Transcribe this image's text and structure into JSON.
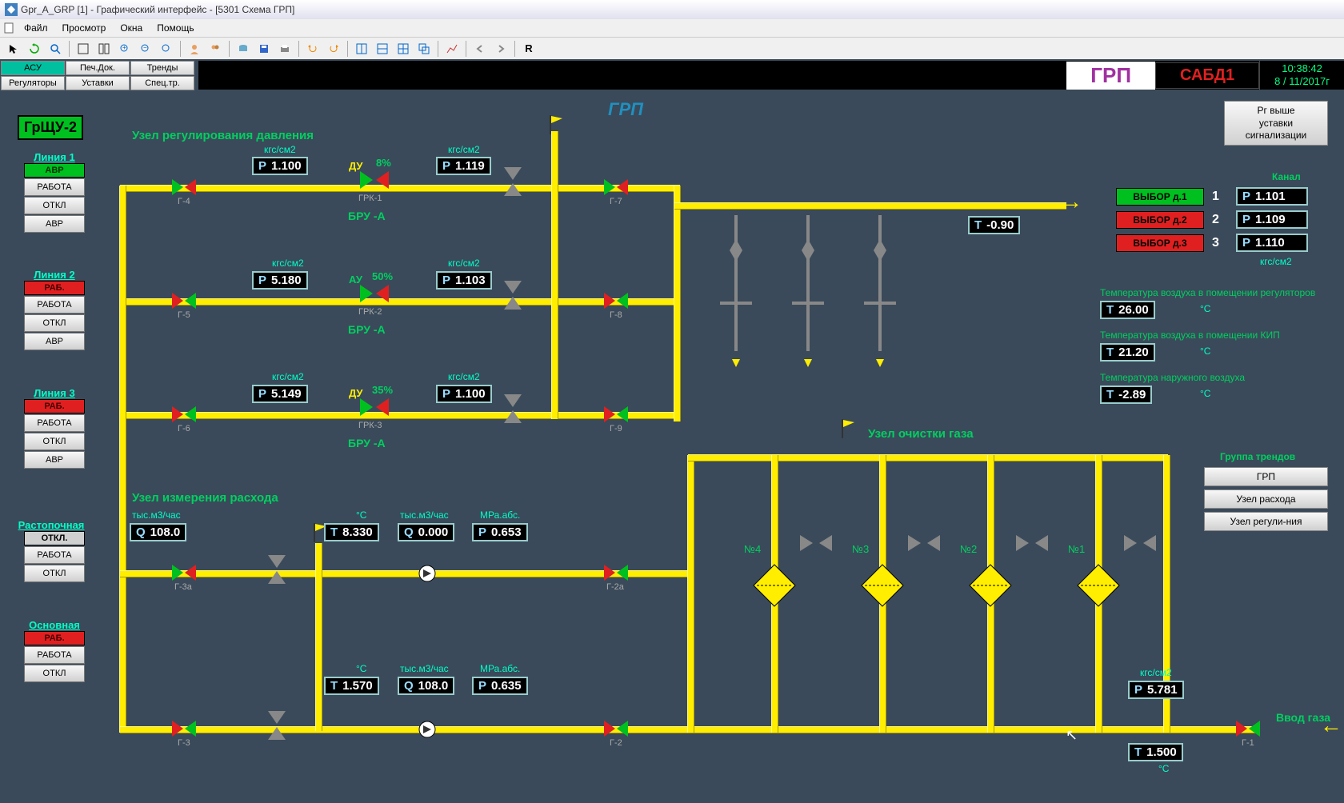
{
  "window": {
    "title": "Gpr_A_GRP [1] - Графический интерфейс - [5301 Схема ГРП]"
  },
  "menu": {
    "file": "Файл",
    "view": "Просмотр",
    "windows": "Окна",
    "help": "Помощь"
  },
  "toolbar_R": "R",
  "topbtns": {
    "r1c1": "АСУ",
    "r1c2": "Печ.Док.",
    "r1c3": "Тренды",
    "r2c1": "Регуляторы",
    "r2c2": "Уставки",
    "r2c3": "Спец.тр."
  },
  "station": "ГРП",
  "alarm": "САБД1",
  "clock": {
    "time": "10:38:42",
    "date": "8 / 11/2017г"
  },
  "main_title": "ГРП",
  "grschu": "ГрЩУ-2",
  "sec": {
    "regul": "Узел регулирования давления",
    "flow": "Узел измерения расхода",
    "clean": "Узел очистки газа"
  },
  "lines": {
    "l1": {
      "name": "Линия 1",
      "status": "АВР",
      "b1": "РАБОТА",
      "b2": "ОТКЛ",
      "b3": "АВР"
    },
    "l2": {
      "name": "Линия 2",
      "status": "РАБ.",
      "b1": "РАБОТА",
      "b2": "ОТКЛ",
      "b3": "АВР"
    },
    "l3": {
      "name": "Линия 3",
      "status": "РАБ.",
      "b1": "РАБОТА",
      "b2": "ОТКЛ",
      "b3": "АВР"
    },
    "rast": {
      "name": "Растопочная",
      "status": "ОТКЛ.",
      "b1": "РАБОТА",
      "b2": "ОТКЛ"
    },
    "osn": {
      "name": "Основная",
      "status": "РАБ.",
      "b1": "РАБОТА",
      "b2": "ОТКЛ"
    }
  },
  "units": {
    "kgs": "кгс/см2",
    "tysm3": "тыс.м3/час",
    "c": "°C",
    "mpa": "МРа.абс."
  },
  "valve_labels": {
    "g4": "Г-4",
    "g5": "Г-5",
    "g6": "Г-6",
    "g7": "Г-7",
    "g8": "Г-8",
    "g9": "Г-9",
    "g3a": "Г-3а",
    "g2a": "Г-2а",
    "g3": "Г-3",
    "g2": "Г-2",
    "g1": "Г-1",
    "grk1": "ГРК-1",
    "grk2": "ГРК-2",
    "grk3": "ГРК-3"
  },
  "bru": "БРУ  -А",
  "mode_du": "ДУ",
  "mode_au": "АУ",
  "percents": {
    "l1": "8%",
    "l2": "50%",
    "l3": "35%"
  },
  "readouts": {
    "l1_p1": "1.100",
    "l1_p2": "1.119",
    "l2_p1": "5.180",
    "l2_p2": "1.103",
    "l3_p1": "5.149",
    "l3_p2": "1.100",
    "t_pipe": "-0.90",
    "flow_q1": "108.0",
    "flow_t1": "8.330",
    "flow_q2": "0.000",
    "flow_p1": "0.653",
    "main_t": "1.570",
    "main_q": "108.0",
    "main_p": "0.635",
    "inlet_p": "5.781",
    "inlet_t": "1.500"
  },
  "alarmbox": {
    "l1": "Рг выше",
    "l2": "уставки",
    "l3": "сигнализации"
  },
  "channel": {
    "title": "Канал",
    "s1": "ВЫБОР д.1",
    "s2": "ВЫБОР д.2",
    "s3": "ВЫБОР д.3",
    "n1": "1",
    "n2": "2",
    "n3": "3",
    "p1": "1.101",
    "p2": "1.109",
    "p3": "1.110",
    "unit": "кгс/см2"
  },
  "temps": {
    "t1_label": "Температура воздуха в помещении регуляторов",
    "t1": "26.00",
    "t2_label": "Температура воздуха в помещении КИП",
    "t2": "21.20",
    "t3_label": "Температура наружного воздуха",
    "t3": "-2.89"
  },
  "trends": {
    "title": "Группа трендов",
    "b1": "ГРП",
    "b2": "Узел расхода",
    "b3": "Узел регули-ния"
  },
  "filters": {
    "n1": "№1",
    "n2": "№2",
    "n3": "№3",
    "n4": "№4"
  },
  "inlet": "Ввод газа"
}
